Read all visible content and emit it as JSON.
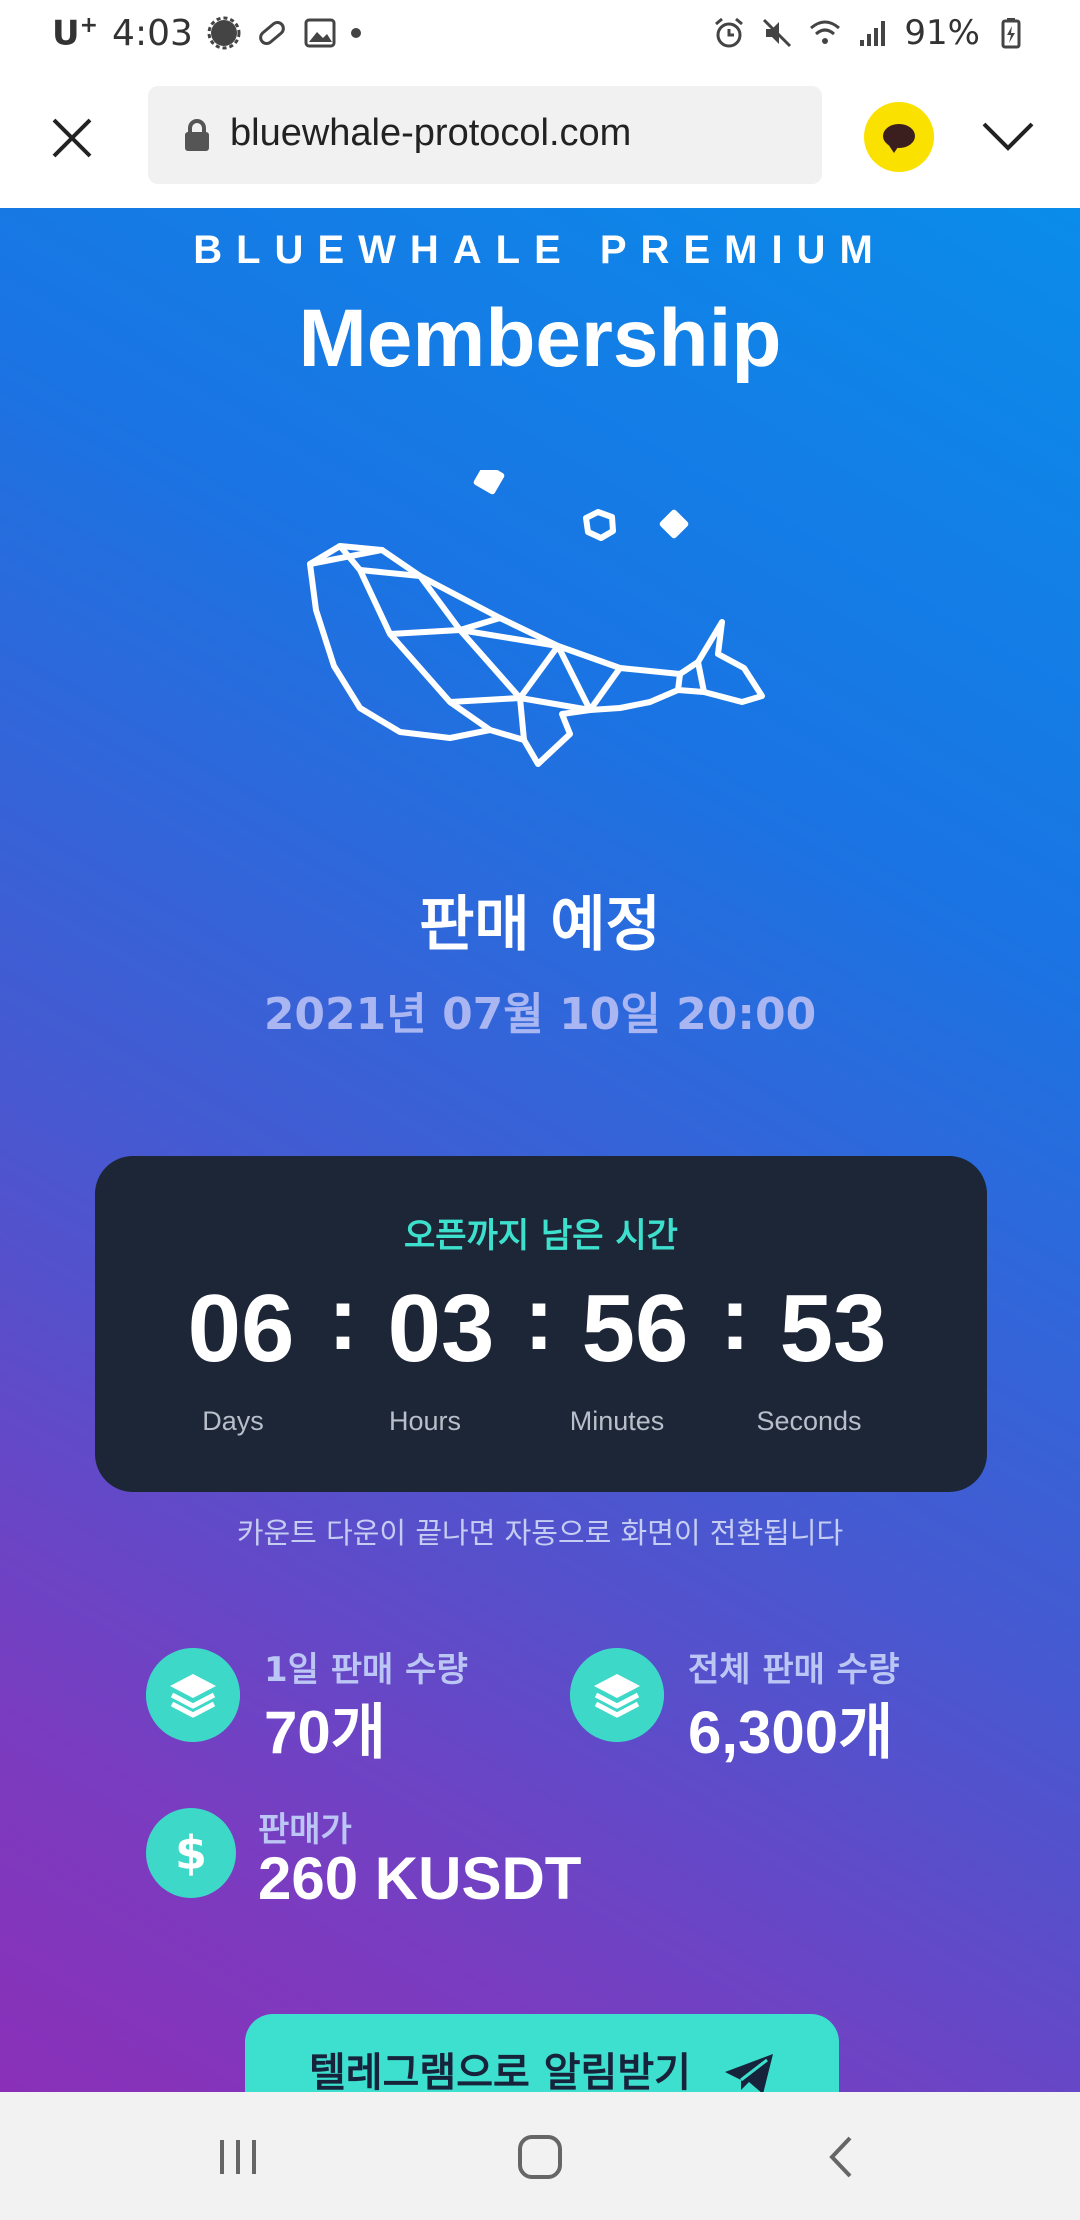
{
  "status_bar": {
    "carrier": "U",
    "carrier_sup": "+",
    "time": "4:03",
    "battery": "91%"
  },
  "browser": {
    "url": "bluewhale-protocol.com"
  },
  "hero": {
    "brand_sub": "BLUEWHALE PREMIUM",
    "brand_title": "Membership"
  },
  "sale": {
    "status": "판매 예정",
    "date": "2021년 07월 10일 20:00"
  },
  "countdown": {
    "title": "오픈까지 남은 시간",
    "days": "06",
    "hours": "03",
    "minutes": "56",
    "seconds": "53",
    "separator": ":",
    "days_label": "Days",
    "hours_label": "Hours",
    "minutes_label": "Minutes",
    "seconds_label": "Seconds",
    "note": "카운트 다운이 끝나면 자동으로 화면이 전환됩니다"
  },
  "stats": {
    "daily_label": "1일 판매 수량",
    "daily_value": "70개",
    "total_label": "전체 판매 수량",
    "total_value": "6,300개",
    "price_label": "판매가",
    "price_value": "260 KUSDT",
    "price_icon_symbol": "$"
  },
  "telegram_button": {
    "label": "텔레그램으로 알림받기"
  },
  "colors": {
    "accent": "#3ed8c8",
    "countdown_bg": "#1c2636",
    "gradient_top": "#0a8cea",
    "gradient_bottom": "#8a30b8"
  },
  "icons": [
    "close-icon",
    "lock-icon",
    "kakaotalk-icon",
    "chevron-down-icon",
    "whale-logo",
    "layers-icon",
    "dollar-icon",
    "telegram-send-icon",
    "recent-apps-icon",
    "home-icon",
    "back-icon"
  ]
}
